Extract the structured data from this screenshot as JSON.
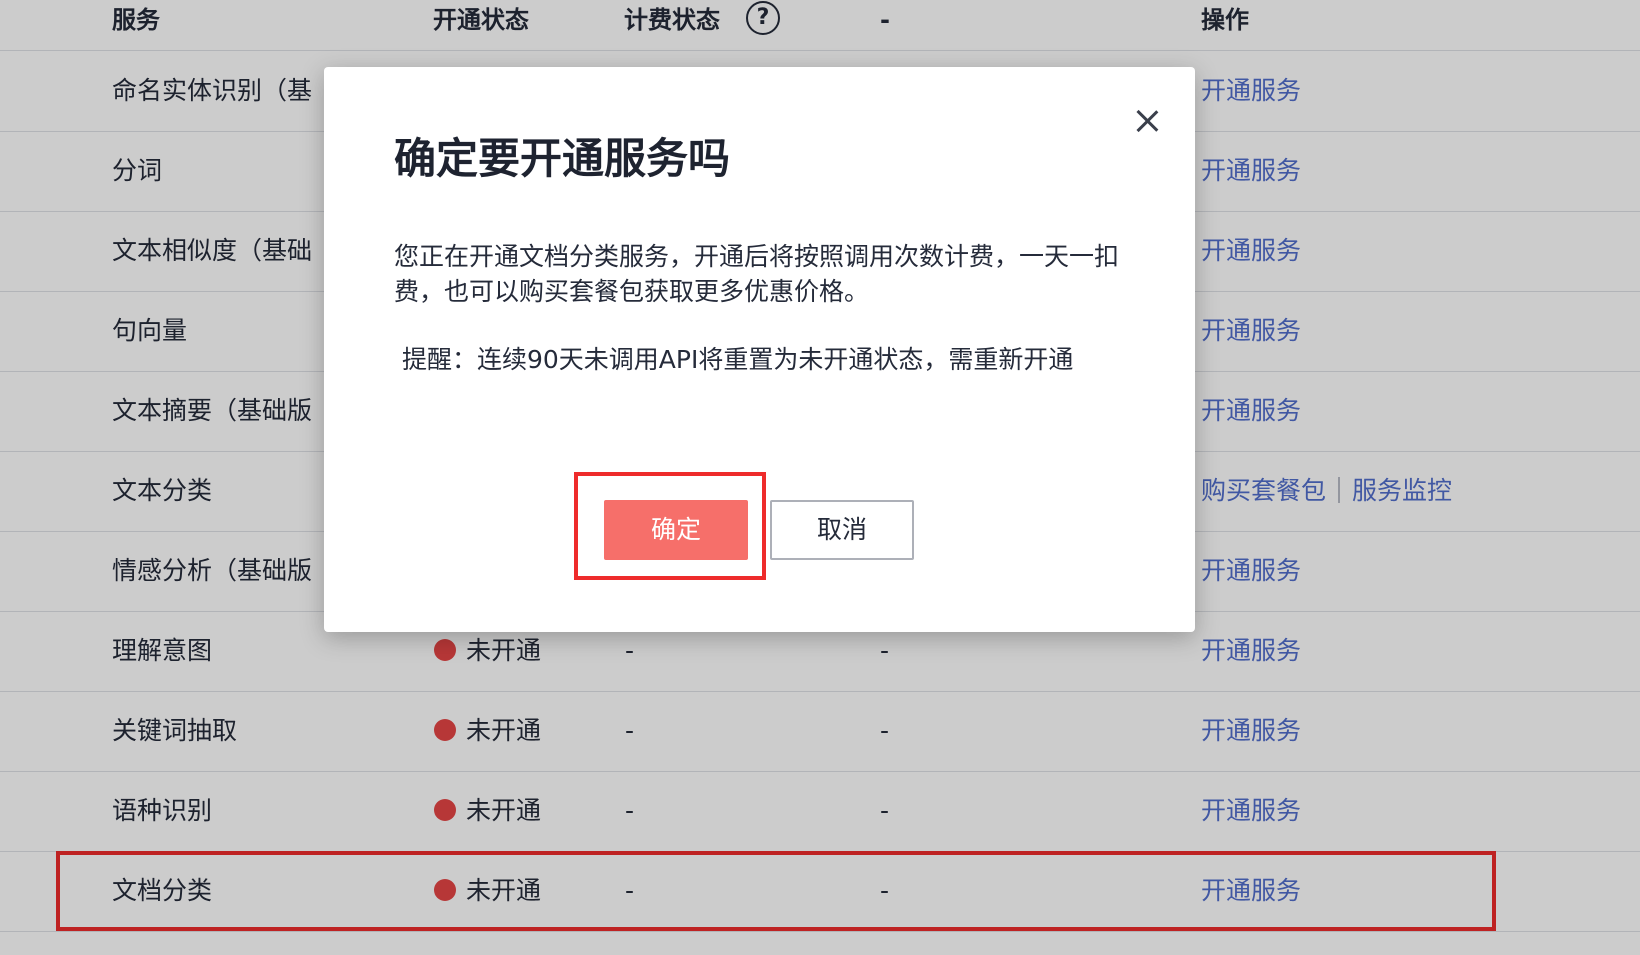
{
  "table": {
    "headers": {
      "service": "服务",
      "open_status": "开通状态",
      "billing_status": "计费状态",
      "help_icon": "?",
      "dash": "-",
      "actions": "操作"
    },
    "rows": [
      {
        "name": "命名实体识别（基",
        "status": "",
        "billing": "",
        "other": "",
        "actions": [
          "开通服务"
        ]
      },
      {
        "name": "分词",
        "status": "",
        "billing": "",
        "other": "",
        "actions": [
          "开通服务"
        ]
      },
      {
        "name": "文本相似度（基础",
        "status": "",
        "billing": "",
        "other": "",
        "actions": [
          "开通服务"
        ]
      },
      {
        "name": "句向量",
        "status": "",
        "billing": "",
        "other": "",
        "actions": [
          "开通服务"
        ]
      },
      {
        "name": "文本摘要（基础版",
        "status": "",
        "billing": "",
        "other": "",
        "actions": [
          "开通服务"
        ]
      },
      {
        "name": "文本分类",
        "status": "",
        "billing": "",
        "other": "",
        "actions": [
          "购买套餐包",
          "服务监控"
        ]
      },
      {
        "name": "情感分析（基础版",
        "status": "",
        "billing": "",
        "other": "",
        "actions": [
          "开通服务"
        ]
      },
      {
        "name": "理解意图",
        "status": "未开通",
        "billing": "-",
        "other": "-",
        "actions": [
          "开通服务"
        ]
      },
      {
        "name": "关键词抽取",
        "status": "未开通",
        "billing": "-",
        "other": "-",
        "actions": [
          "开通服务"
        ]
      },
      {
        "name": "语种识别",
        "status": "未开通",
        "billing": "-",
        "other": "-",
        "actions": [
          "开通服务"
        ]
      },
      {
        "name": "文档分类",
        "status": "未开通",
        "billing": "-",
        "other": "-",
        "actions": [
          "开通服务"
        ]
      }
    ]
  },
  "modal": {
    "title": "确定要开通服务吗",
    "message": " 您正在开通文档分类服务，开通后将按照调用次数计费，一天一扣费，也可以购买套餐包获取更多优惠价格。",
    "reminder": "提醒：连续90天未调用API将重置为未开通状态，需重新开通",
    "confirm_label": "确定",
    "cancel_label": "取消"
  },
  "colors": {
    "status_dot": "#e54545",
    "link": "#526ecc",
    "confirm_button": "#f66f6a",
    "highlight_box": "#ee2b2b"
  },
  "icons": {
    "help": "question-circle-icon",
    "close": "close-icon",
    "status": "status-dot-icon"
  }
}
